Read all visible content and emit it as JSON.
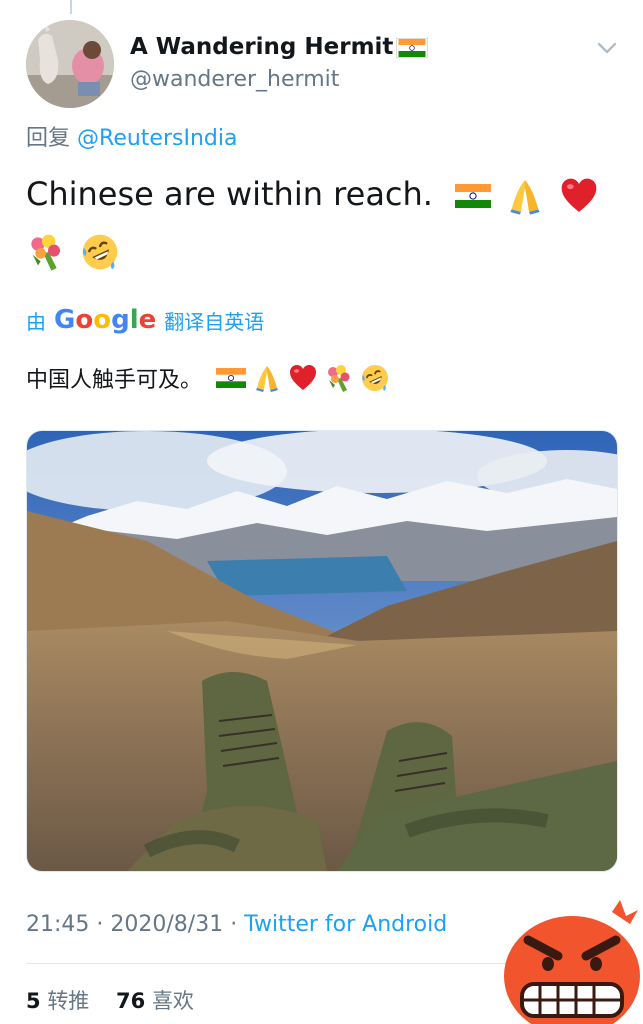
{
  "tweet": {
    "display_name": "A Wandering Hermit",
    "handle": "@wanderer_hermit",
    "reply_prefix": "回复",
    "reply_mention": "@ReutersIndia",
    "text": "Chinese are within reach.",
    "emojis": [
      "india-flag",
      "folded-hands",
      "red-heart",
      "bouquet",
      "rolling-laughing"
    ]
  },
  "translation": {
    "by": "由",
    "google_letters": [
      "G",
      "o",
      "o",
      "g",
      "l",
      "e"
    ],
    "google_colors": [
      "#4285F4",
      "#EA4335",
      "#FBBC05",
      "#4285F4",
      "#34A853",
      "#EA4335"
    ],
    "rest": "翻译自英语",
    "text": "中国人触手可及。"
  },
  "meta": {
    "time": "21:45",
    "date": "2020/8/31",
    "source": "Twitter for Android",
    "separator": " · "
  },
  "stats": {
    "retweets_count": "5",
    "retweets_label": "转推",
    "likes_count": "76",
    "likes_label": "喜欢"
  },
  "colors": {
    "link": "#1da1f2",
    "secondary": "#657786",
    "text": "#14171a"
  }
}
